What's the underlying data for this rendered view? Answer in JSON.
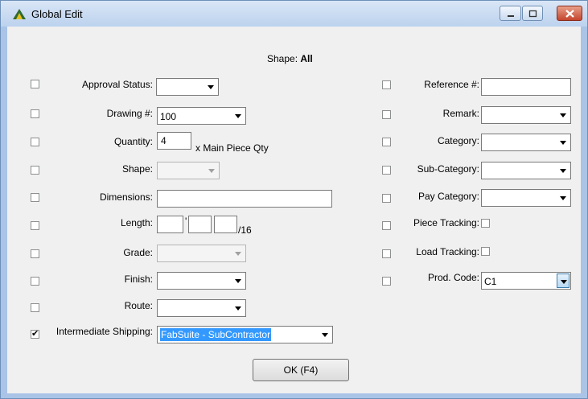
{
  "window": {
    "title": "Global Edit",
    "app_icon": "fabsuite-icon"
  },
  "header": {
    "shape_label": "Shape:",
    "shape_value": "All"
  },
  "left": {
    "approval_status": {
      "label": "Approval Status:",
      "value": ""
    },
    "drawing": {
      "label": "Drawing #:",
      "value": "100"
    },
    "quantity": {
      "label": "Quantity:",
      "value": "4",
      "suffix": "x Main Piece Qty"
    },
    "shape": {
      "label": "Shape:",
      "value": ""
    },
    "dimensions": {
      "label": "Dimensions:",
      "value": ""
    },
    "length": {
      "label": "Length:",
      "feet": "",
      "inches": "",
      "sixteenths": "",
      "unit_mark": "'",
      "suffix": "/16"
    },
    "grade": {
      "label": "Grade:",
      "value": ""
    },
    "finish": {
      "label": "Finish:",
      "value": ""
    },
    "route": {
      "label": "Route:",
      "value": ""
    },
    "intermediate_shipping": {
      "label": "Intermediate Shipping:",
      "value": "FabSuite - SubContractor",
      "checked": true
    }
  },
  "right": {
    "reference": {
      "label": "Reference #:",
      "value": ""
    },
    "remark": {
      "label": "Remark:",
      "value": ""
    },
    "category": {
      "label": "Category:",
      "value": ""
    },
    "sub_category": {
      "label": "Sub-Category:",
      "value": ""
    },
    "pay_category": {
      "label": "Pay Category:",
      "value": ""
    },
    "piece_tracking": {
      "label": "Piece Tracking:"
    },
    "load_tracking": {
      "label": "Load Tracking:"
    },
    "prod_code": {
      "label": "Prod. Code:",
      "value": "C1"
    }
  },
  "buttons": {
    "ok": "OK (F4)"
  }
}
